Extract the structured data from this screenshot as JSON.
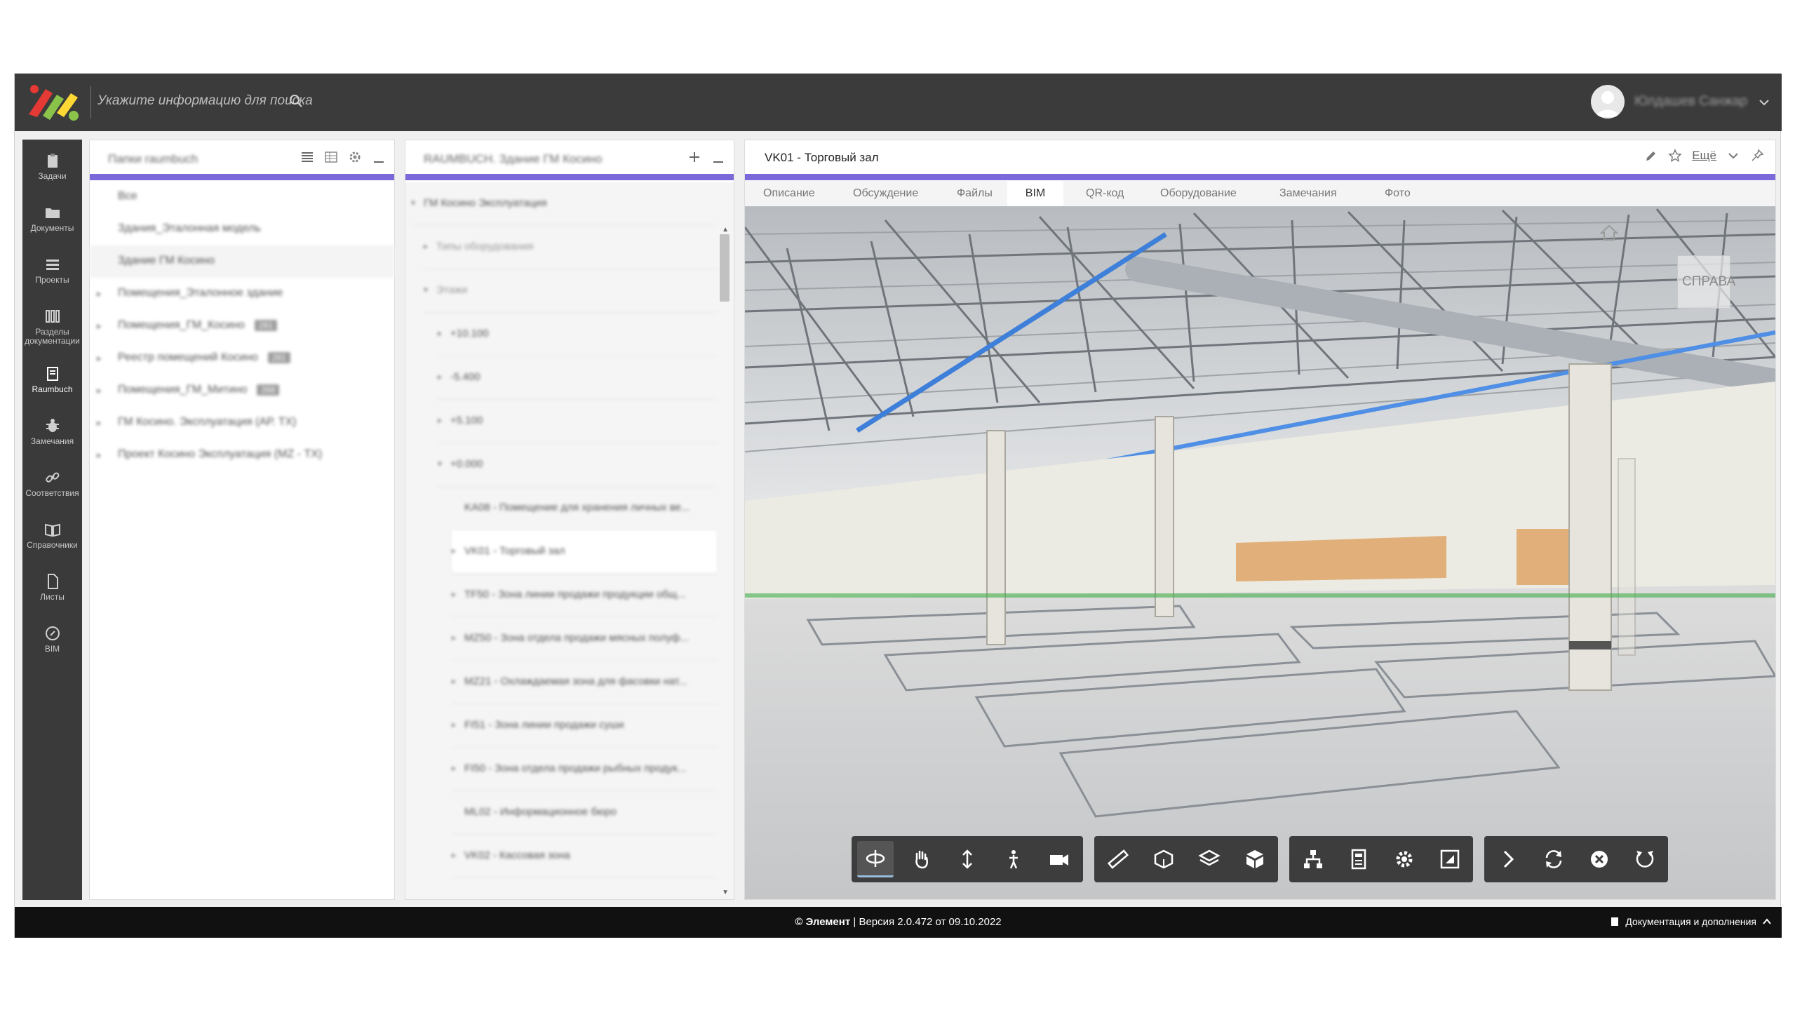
{
  "header": {
    "search_placeholder": "Укажите информацию для поиска",
    "user_name": "Юлдашев Санжар"
  },
  "nav": {
    "items": [
      {
        "label": "Задачи",
        "icon": "clipboard-icon"
      },
      {
        "label": "Документы",
        "icon": "folder-icon"
      },
      {
        "label": "Проекты",
        "icon": "list-icon"
      },
      {
        "label": "Разделы документации",
        "icon": "sections-icon"
      },
      {
        "label": "Raumbuch",
        "icon": "book-icon"
      },
      {
        "label": "Замечания",
        "icon": "bug-icon"
      },
      {
        "label": "Соответствия",
        "icon": "link-icon"
      },
      {
        "label": "Справочники",
        "icon": "open-book-icon"
      },
      {
        "label": "Листы",
        "icon": "sheet-icon"
      },
      {
        "label": "BIM",
        "icon": "compass-icon"
      }
    ],
    "active": "Raumbuch"
  },
  "folders_panel": {
    "title": "Папки raumbuch",
    "items": [
      {
        "label": "Все",
        "badge": ""
      },
      {
        "label": "Здания_Эталонная модель",
        "badge": ""
      },
      {
        "label": "Здание ГМ Косино",
        "badge": ""
      },
      {
        "label": "Помещения_Эталонное здание",
        "badge": ""
      },
      {
        "label": "Помещения_ГМ_Косино",
        "badge": "281"
      },
      {
        "label": "Реестр помещений Косино",
        "badge": "281"
      },
      {
        "label": "Помещения_ГМ_Митино",
        "badge": "268"
      },
      {
        "label": "ГМ Косино. Эксплуатация (АР. ТХ)",
        "badge": ""
      },
      {
        "label": "Проект Косино Эксплуатация (МZ - ТХ)",
        "badge": ""
      }
    ]
  },
  "tree_panel": {
    "title": "RAUMBUCH. Здание ГМ Косино",
    "items": [
      {
        "label": "ГМ Косино Эксплуатация"
      },
      {
        "label": "Типы оборудования"
      },
      {
        "label": "Этажи"
      },
      {
        "label": "+10.100"
      },
      {
        "label": "-5.400"
      },
      {
        "label": "+5.100"
      },
      {
        "label": "+0.000"
      },
      {
        "label": "KA08 - Помещение для хранения личных ве..."
      },
      {
        "label": "VK01 - Торговый зал"
      },
      {
        "label": "TF50 - Зона линии продажи продукции общ..."
      },
      {
        "label": "MZ50 - Зона отдела продажи мясных полуф..."
      },
      {
        "label": "MZ21 - Охлаждаемая зона для фасовки нат..."
      },
      {
        "label": "FI51 - Зона линии продажи суши"
      },
      {
        "label": "FI50 - Зона отдела продажи рыбных продук..."
      },
      {
        "label": "ML02 - Информационное бюро"
      },
      {
        "label": "VK02 - Кассовая зона"
      }
    ]
  },
  "detail": {
    "title": "VK01 - Торговый зал",
    "more_label": "Ещё",
    "tabs": [
      "Описание",
      "Обсуждение",
      "Файлы",
      "BIM",
      "QR-код",
      "Оборудование",
      "Замечания",
      "Фото"
    ],
    "active_tab": "BIM",
    "navcube_label": "СПРАВА"
  },
  "footer": {
    "copyright": "© Элемент",
    "version": "Версия 2.0.472 от 09.10.2022",
    "docs_label": "Документация и дополнения"
  },
  "colors": {
    "accent": "#7b68d9",
    "header_bg": "#3b3b3b",
    "footer_bg": "#111111"
  }
}
